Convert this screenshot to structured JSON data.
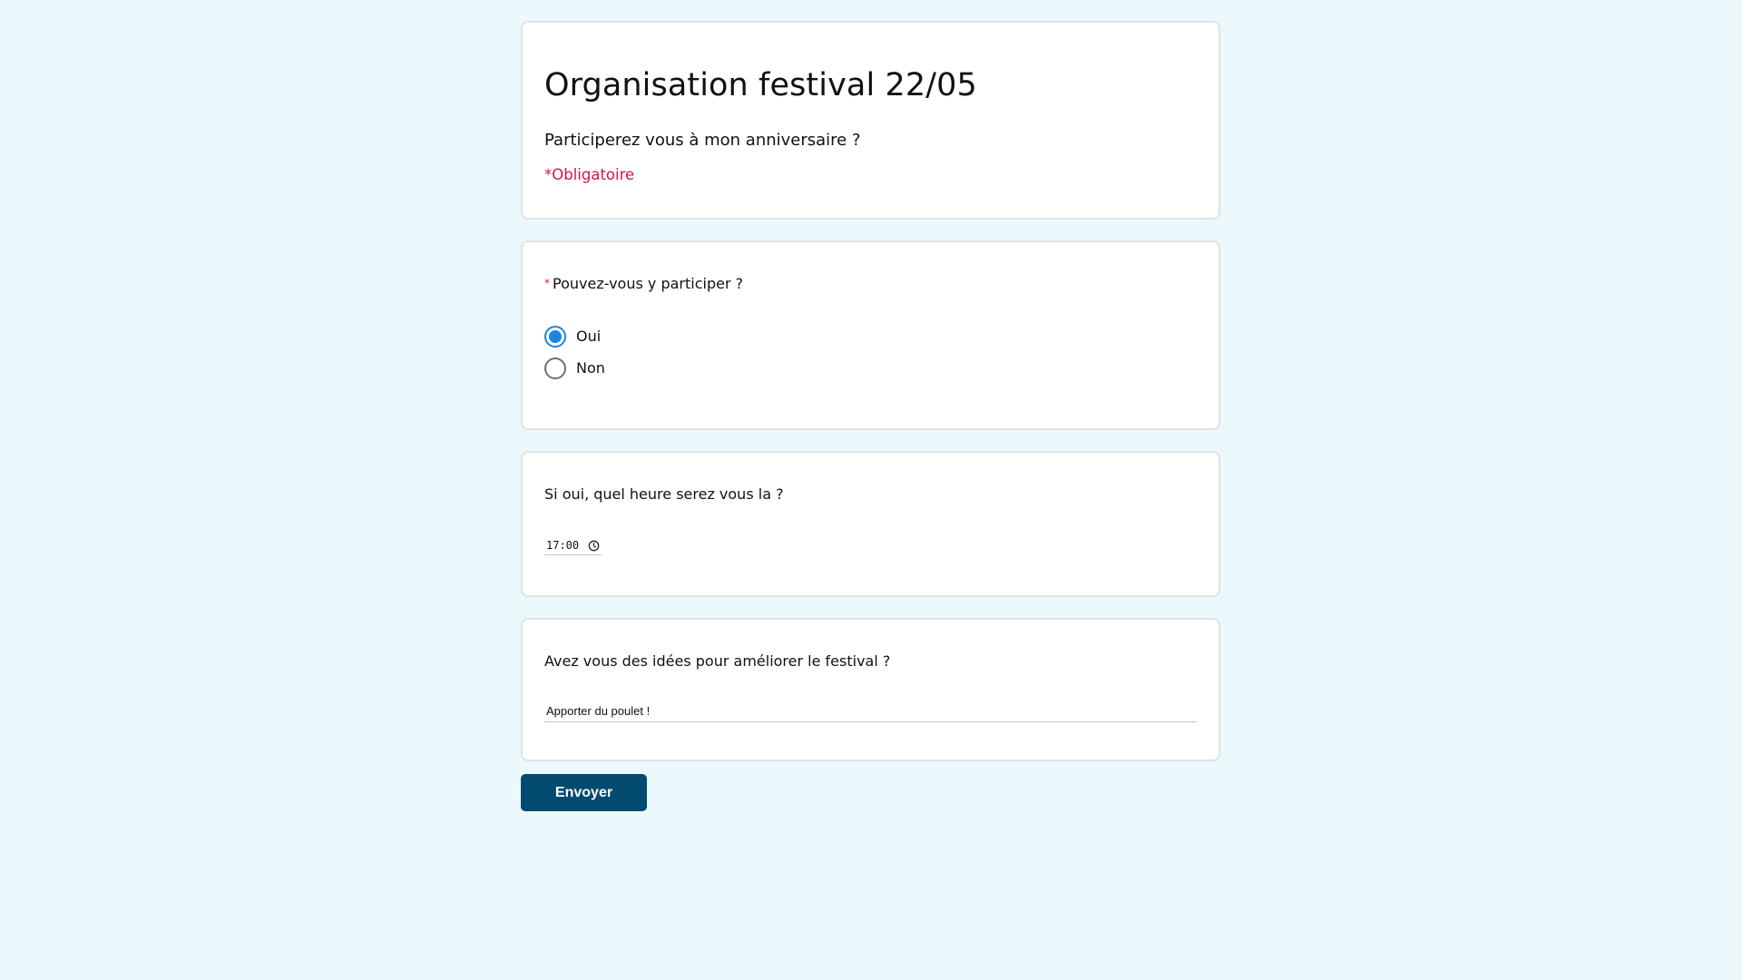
{
  "header": {
    "title": "Organisation festival 22/05",
    "subtitle": "Participerez vous à mon anniversaire ?",
    "required_note": "*Obligatoire"
  },
  "question_attendance": {
    "asterisk": "*",
    "label": "Pouvez-vous y participer ?",
    "options": [
      {
        "label": "Oui",
        "selected": true
      },
      {
        "label": "Non",
        "selected": false
      }
    ]
  },
  "question_time": {
    "label": "Si oui, quel heure serez vous la ?",
    "value": "17:00",
    "icon": "clock-icon"
  },
  "question_ideas": {
    "label": "Avez vous des idées pour améliorer le festival ?",
    "value": "Apporter du poulet !"
  },
  "submit": {
    "label": "Envoyer"
  },
  "colors": {
    "background": "#ebf8fc",
    "required": "#d2164b",
    "radio_selected": "#1a86e0",
    "button": "#034a70"
  }
}
